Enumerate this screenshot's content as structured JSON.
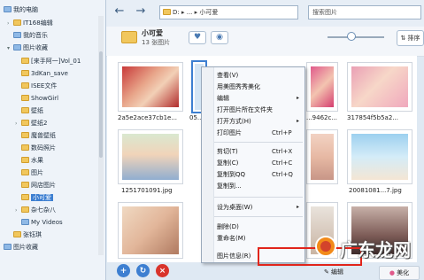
{
  "sidebar": {
    "items": [
      {
        "label": "我的电脑",
        "expander": ""
      },
      {
        "label": "IT168编辑",
        "expander": "›"
      },
      {
        "label": "我的音乐",
        "expander": ""
      },
      {
        "label": "图片收藏",
        "expander": "▾"
      },
      {
        "label": "[来手阿一]Vol_01",
        "expander": ""
      },
      {
        "label": "3dKan_save",
        "expander": ""
      },
      {
        "label": "ISEE文件",
        "expander": ""
      },
      {
        "label": "ShowGirl",
        "expander": ""
      },
      {
        "label": "壁纸",
        "expander": ""
      },
      {
        "label": "壁纸2",
        "expander": "›"
      },
      {
        "label": "魔兽壁纸",
        "expander": ""
      },
      {
        "label": "数码照片",
        "expander": ""
      },
      {
        "label": "水果",
        "expander": ""
      },
      {
        "label": "图片",
        "expander": ""
      },
      {
        "label": "网店图片",
        "expander": ""
      },
      {
        "label": "小可爱",
        "expander": ""
      },
      {
        "label": "杂七杂八",
        "expander": "›"
      },
      {
        "label": "My Videos",
        "expander": ""
      },
      {
        "label": "张钰琪",
        "expander": ""
      },
      {
        "label": "图片收藏",
        "expander": ""
      }
    ]
  },
  "topbar": {
    "back_icon": "back-arrow-icon",
    "forward_icon": "forward-arrow-icon",
    "address": "D: ▸ ... ▸ 小可爱",
    "search_placeholder": "搜索图片"
  },
  "header": {
    "title": "小可爱",
    "count": "13 张图片",
    "sort_label": "排序"
  },
  "thumbnails": [
    {
      "caption": "2a5e2ace37cb1e..."
    },
    {
      "caption": "05..."
    },
    {
      "caption": "...9462c..."
    },
    {
      "caption": "317854f5b5a2..."
    },
    {
      "caption": "1251701091.jpg"
    },
    {
      "caption": ""
    },
    {
      "caption": ""
    },
    {
      "caption": "20081081...7.jpg"
    },
    {
      "caption": ""
    },
    {
      "caption": ""
    },
    {
      "caption": ""
    },
    {
      "caption": ""
    }
  ],
  "context_menu": {
    "items": [
      {
        "label": "查看(V)",
        "shortcut": "",
        "arrow": ""
      },
      {
        "label": "用美图秀秀美化",
        "shortcut": "",
        "arrow": ""
      },
      {
        "label": "编辑",
        "shortcut": "",
        "arrow": "▸"
      },
      {
        "label": "打开图片所在文件夹",
        "shortcut": "",
        "arrow": ""
      },
      {
        "label": "打开方式(H)",
        "shortcut": "",
        "arrow": "▸"
      },
      {
        "label": "打印图片",
        "shortcut": "Ctrl+P",
        "arrow": ""
      },
      {
        "label": "剪切(T)",
        "shortcut": "Ctrl+X",
        "arrow": ""
      },
      {
        "label": "复制(C)",
        "shortcut": "Ctrl+C",
        "arrow": ""
      },
      {
        "label": "复制到QQ",
        "shortcut": "Ctrl+Q",
        "arrow": ""
      },
      {
        "label": "复制到...",
        "shortcut": "",
        "arrow": ""
      },
      {
        "label": "设为桌面(W)",
        "shortcut": "",
        "arrow": "▸"
      },
      {
        "label": "删除(D)",
        "shortcut": "",
        "arrow": ""
      },
      {
        "label": "重命名(M)",
        "shortcut": "",
        "arrow": ""
      },
      {
        "label": "图片信息(R)",
        "shortcut": "",
        "arrow": ""
      }
    ]
  },
  "bottom": {
    "edit_label": "编辑",
    "beautify_label": "美化",
    "watermark_text": "广东龙网"
  },
  "colors": {
    "accent": "#3d7fd1",
    "highlight_border": "#e1251b"
  }
}
